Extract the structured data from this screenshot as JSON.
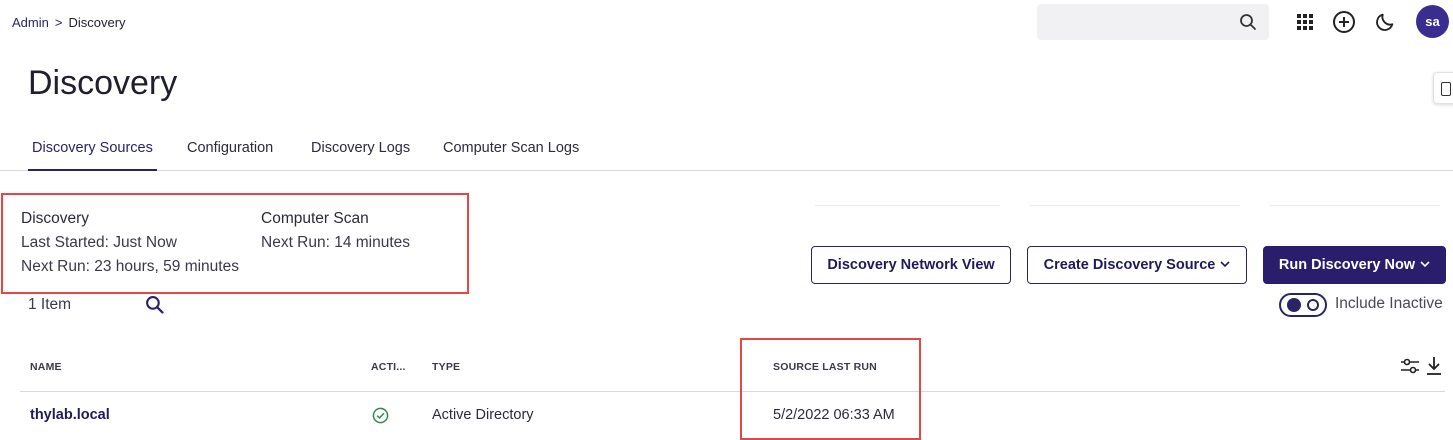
{
  "breadcrumb": {
    "parent": "Admin",
    "separator": ">",
    "current": "Discovery"
  },
  "header": {
    "search_placeholder": "",
    "avatar_initials": "sa"
  },
  "page": {
    "title": "Discovery"
  },
  "tabs": [
    {
      "label": "Discovery Sources",
      "active": true
    },
    {
      "label": "Configuration",
      "active": false
    },
    {
      "label": "Discovery Logs",
      "active": false
    },
    {
      "label": "Computer Scan Logs",
      "active": false
    }
  ],
  "status": {
    "discovery": {
      "heading": "Discovery",
      "last_started": "Last Started: Just Now",
      "next_run": "Next Run: 23 hours, 59 minutes"
    },
    "computer_scan": {
      "heading": "Computer Scan",
      "next_run": "Next Run: 14 minutes"
    }
  },
  "actions": {
    "network_view": "Discovery Network View",
    "create_source": "Create Discovery Source",
    "run_now": "Run Discovery Now"
  },
  "list": {
    "count": "1 Item",
    "include_inactive_label": "Include Inactive",
    "include_inactive_on": true
  },
  "table": {
    "columns": [
      "NAME",
      "ACTI...",
      "TYPE",
      "SOURCE LAST RUN"
    ],
    "rows": [
      {
        "name": "thylab.local",
        "active": true,
        "type": "Active Directory",
        "source_last_run": "5/2/2022 06:33 AM"
      }
    ]
  },
  "colors": {
    "accent": "#2a1d6b",
    "highlight": "#e84545",
    "success": "#2e8b57"
  }
}
